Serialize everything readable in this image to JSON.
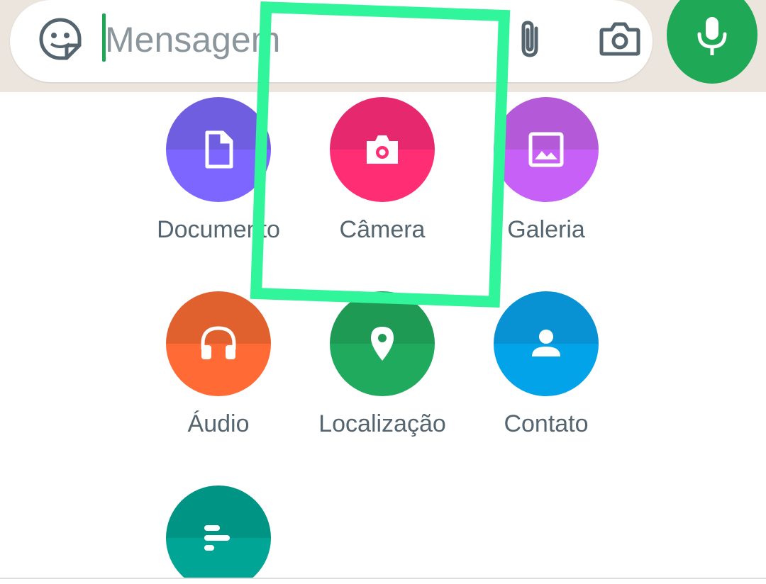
{
  "compose": {
    "placeholder": "Mensagem"
  },
  "icons": {
    "emoji": "sticker-emoji-icon",
    "attach": "paperclip-icon",
    "camera": "camera-icon",
    "mic": "microphone-icon"
  },
  "attachments": [
    {
      "label": "Documento",
      "icon": "document-icon",
      "color_top": "#6f5ee0",
      "color_bottom": "#7d66ff"
    },
    {
      "label": "Câmera",
      "icon": "camera-icon",
      "color_top": "#e6296e",
      "color_bottom": "#ff2e74"
    },
    {
      "label": "Galeria",
      "icon": "gallery-icon",
      "color_top": "#b45ad8",
      "color_bottom": "#c660f7"
    },
    {
      "label": "Áudio",
      "icon": "headphones-icon",
      "color_top": "#e1612e",
      "color_bottom": "#ff6a35"
    },
    {
      "label": "Localização",
      "icon": "location-pin-icon",
      "color_top": "#1e9a55",
      "color_bottom": "#1faa5d"
    },
    {
      "label": "Contato",
      "icon": "contact-person-icon",
      "color_top": "#0992d3",
      "color_bottom": "#03a3ea"
    },
    {
      "label": "",
      "icon": "poll-icon",
      "color_top": "#009485",
      "color_bottom": "#00a595"
    }
  ],
  "colors": {
    "accent": "#1fa855",
    "highlight": "#30f59a"
  }
}
